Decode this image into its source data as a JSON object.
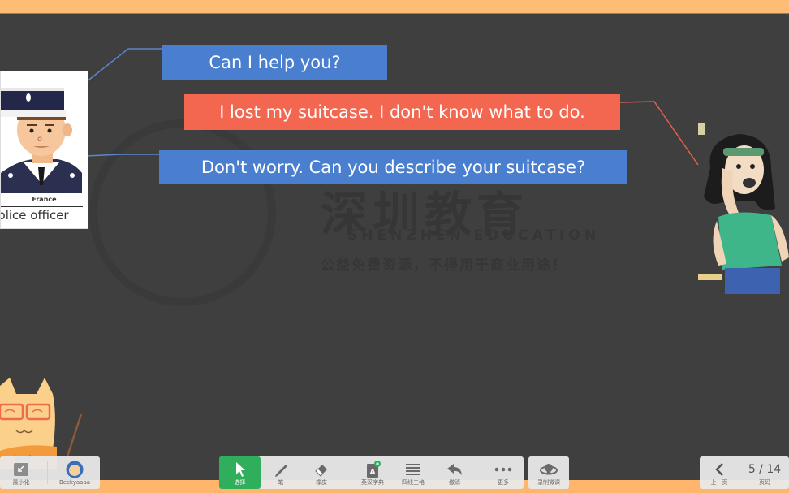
{
  "watermark": {
    "title_cn": "深圳教育",
    "title_en": "SHENZHEN EDUCATION",
    "notice_cn": "公益免费资源，不得用于商业用途！"
  },
  "card": {
    "country": "France",
    "title": "Police officer"
  },
  "dialogue": [
    {
      "speaker": "police-officer",
      "text": "Can I help you?",
      "color": "#4a7fd0"
    },
    {
      "speaker": "tourist",
      "text": "I lost my suitcase. I don't know what to do.",
      "color": "#f36650"
    },
    {
      "speaker": "police-officer",
      "text": "Don't worry. Can you describe your suitcase?",
      "color": "#4a7fd0"
    }
  ],
  "toolbar": {
    "left": [
      {
        "icon": "minimize-icon",
        "label": "最小化"
      },
      {
        "icon": "avatar-icon",
        "label": "Beckyaaaa"
      }
    ],
    "tools": [
      {
        "icon": "cursor-icon",
        "label": "选择",
        "active": true
      },
      {
        "icon": "pen-icon",
        "label": "笔"
      },
      {
        "icon": "eraser-icon",
        "label": "橡皮"
      },
      {
        "icon": "dictionary-icon",
        "label": "英汉字典"
      },
      {
        "icon": "four-lines-icon",
        "label": "四线三格"
      },
      {
        "icon": "undo-icon",
        "label": "撤消"
      },
      {
        "icon": "more-icon",
        "label": "更多"
      }
    ],
    "record": {
      "icon": "record-icon",
      "label": "录制微课"
    },
    "nav": {
      "prev_label": "上一页",
      "page_label": "页码",
      "current_page": 5,
      "total_pages": 14,
      "page_text": "5 / 14"
    }
  },
  "colors": {
    "frame": "#ffbc74",
    "board": "#3f3f3f",
    "active_tool": "#2fae5c",
    "blue_bubble": "#4a7fd0",
    "red_bubble": "#f36650"
  }
}
